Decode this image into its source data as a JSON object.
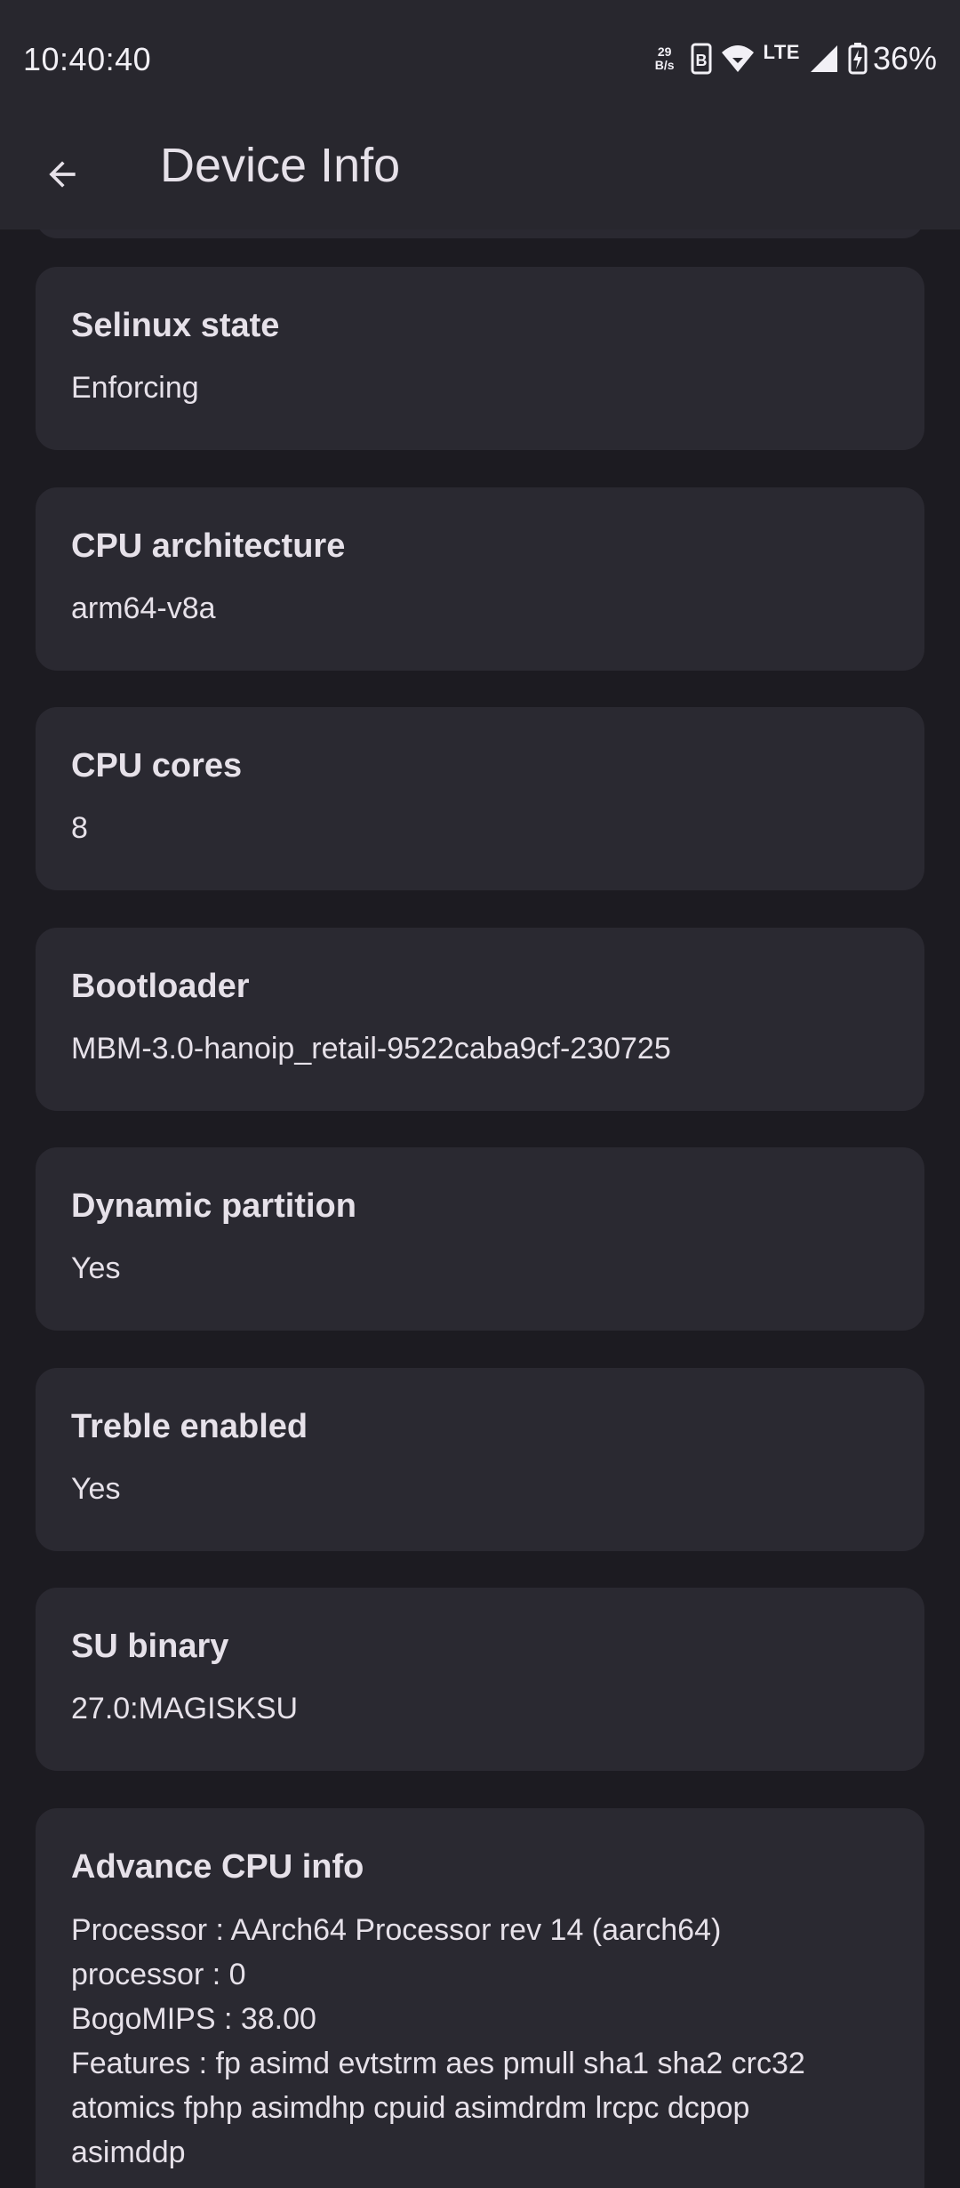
{
  "status_bar": {
    "time": "10:40:40",
    "net_speed_value": "29",
    "net_speed_unit": "B/s",
    "network_type": "LTE",
    "battery_percent": "36%"
  },
  "app_bar": {
    "title": "Device Info"
  },
  "cards": [
    {
      "title": "Selinux state",
      "value": "Enforcing"
    },
    {
      "title": "CPU architecture",
      "value": "arm64-v8a"
    },
    {
      "title": "CPU cores",
      "value": "8"
    },
    {
      "title": "Bootloader",
      "value": "MBM-3.0-hanoip_retail-9522caba9cf-230725"
    },
    {
      "title": "Dynamic partition",
      "value": "Yes"
    },
    {
      "title": "Treble enabled",
      "value": "Yes"
    },
    {
      "title": "SU binary",
      "value": "27.0:MAGISKSU"
    }
  ],
  "advance_cpu": {
    "title": "Advance CPU info",
    "lines": [
      "Processor : AArch64 Processor rev 14 (aarch64)",
      "processor : 0",
      "BogoMIPS : 38.00",
      "Features : fp asimd evtstrm aes pmull sha1 sha2 crc32",
      "atomics fphp asimdhp cpuid asimdrdm lrcpc dcpop",
      "asimddp"
    ]
  },
  "colors": {
    "background": "#1c1b21",
    "surface": "#2a2931",
    "app_bar": "#28272e",
    "text": "#e6e1e9"
  }
}
